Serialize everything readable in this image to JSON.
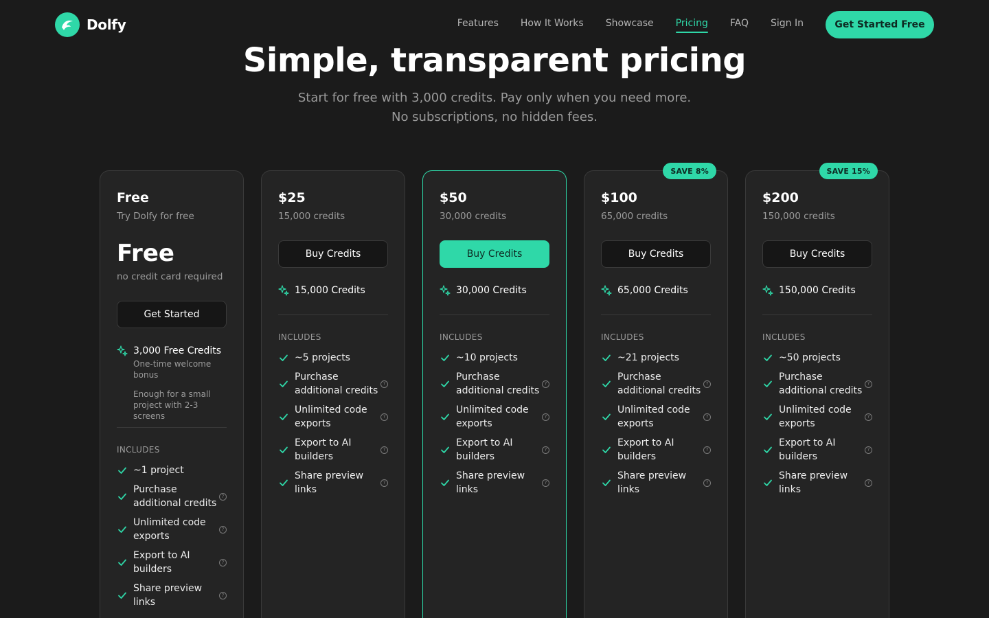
{
  "brand": {
    "name": "Dolfy"
  },
  "nav": {
    "links": [
      "Features",
      "How It Works",
      "Showcase",
      "Pricing",
      "FAQ",
      "Sign In"
    ],
    "active": "Pricing",
    "cta": "Get Started Free"
  },
  "hero": {
    "title": "Simple, transparent pricing",
    "subtitle": "Start for free with 3,000 credits. Pay only when you need more. No subscriptions, no hidden fees."
  },
  "colors": {
    "accent": "#2fd8a8",
    "background": "#1b1b1b",
    "card": "#242424"
  },
  "plans": [
    {
      "name": "Free",
      "desc": "Try Dolfy for free",
      "price_big": "Free",
      "price_note": "no credit card required",
      "button": "Get Started",
      "credits": "3,000 Free Credits",
      "credits_sub1": "One-time welcome bonus",
      "credits_sub2": "Enough for a small project with 2-3 screens",
      "includes_label": "INCLUDES",
      "features": [
        "~1 project",
        "Purchase additional credits",
        "Unlimited code exports",
        "Export to AI builders",
        "Share preview links"
      ]
    },
    {
      "name": "$25",
      "desc": "15,000 credits",
      "button": "Buy Credits",
      "credits": "15,000 Credits",
      "includes_label": "INCLUDES",
      "features": [
        "~5 projects",
        "Purchase additional credits",
        "Unlimited code exports",
        "Export to AI builders",
        "Share preview links"
      ]
    },
    {
      "name": "$50",
      "desc": "30,000 credits",
      "button": "Buy Credits",
      "featured": true,
      "credits": "30,000 Credits",
      "includes_label": "INCLUDES",
      "features": [
        "~10 projects",
        "Purchase additional credits",
        "Unlimited code exports",
        "Export to AI builders",
        "Share preview links"
      ]
    },
    {
      "name": "$100",
      "desc": "65,000 credits",
      "button": "Buy Credits",
      "badge": "SAVE 8%",
      "credits": "65,000 Credits",
      "includes_label": "INCLUDES",
      "features": [
        "~21 projects",
        "Purchase additional credits",
        "Unlimited code exports",
        "Export to AI builders",
        "Share preview links"
      ]
    },
    {
      "name": "$200",
      "desc": "150,000 credits",
      "button": "Buy Credits",
      "badge": "SAVE 15%",
      "credits": "150,000 Credits",
      "includes_label": "INCLUDES",
      "features": [
        "~50 projects",
        "Purchase additional credits",
        "Unlimited code exports",
        "Export to AI builders",
        "Share preview links"
      ]
    }
  ]
}
